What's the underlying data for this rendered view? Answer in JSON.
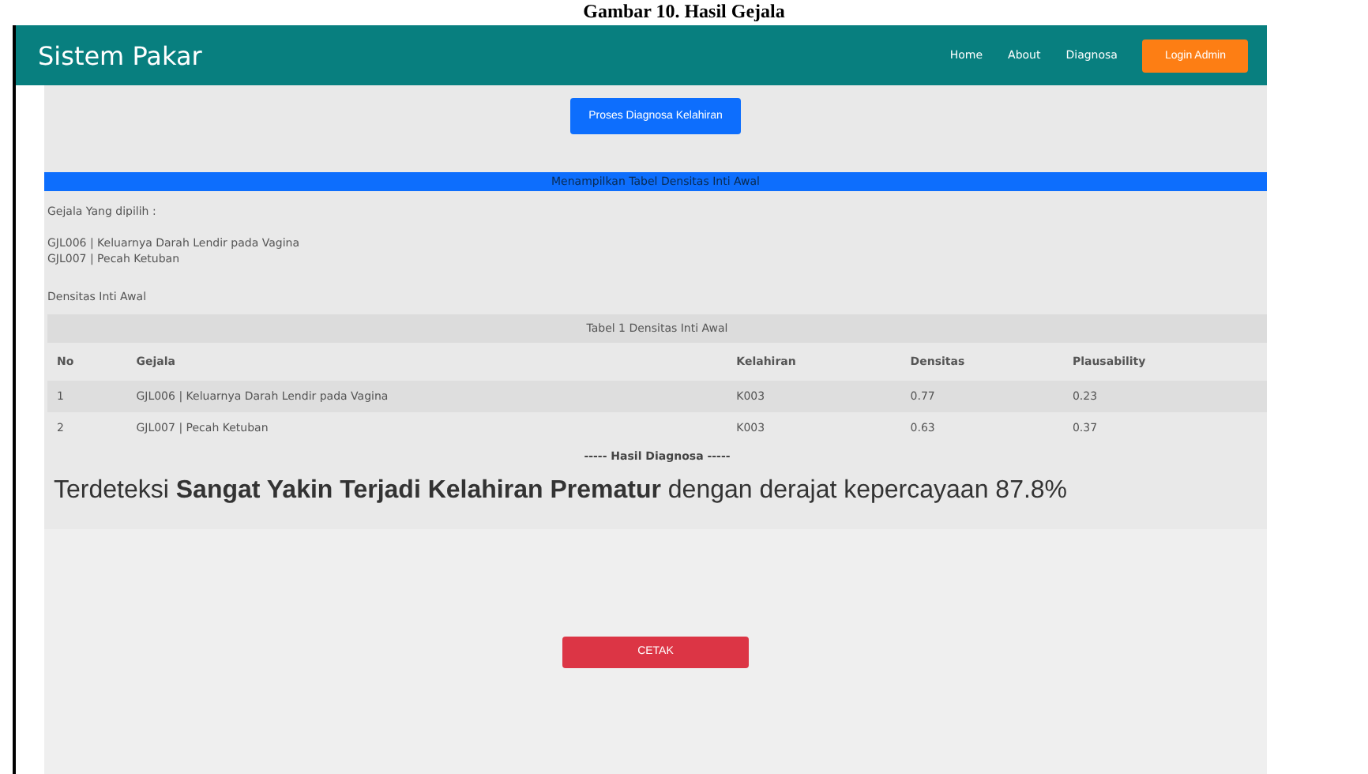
{
  "caption": "Gambar 10. Hasil Gejala",
  "navbar": {
    "brand": "Sistem Pakar",
    "links": [
      "Home",
      "About",
      "Diagnosa"
    ],
    "login_button": "Login Admin"
  },
  "process_button": "Proses Diagnosa Kelahiran",
  "section_bar": "Menampilkan Tabel Densitas Inti Awal",
  "selected_label": "Gejala Yang dipilih :",
  "selected_symptoms": [
    "GJL006 | Keluarnya Darah Lendir pada Vagina",
    "GJL007 | Pecah Ketuban"
  ],
  "density_label": "Densitas Inti Awal",
  "table": {
    "caption": "Tabel 1 Densitas Inti Awal",
    "columns": [
      "No",
      "Gejala",
      "Kelahiran",
      "Densitas",
      "Plausability"
    ],
    "rows": [
      [
        "1",
        "GJL006 | Keluarnya Darah Lendir pada Vagina",
        "K003",
        "0.77",
        "0.23"
      ],
      [
        "2",
        "GJL007 | Pecah Ketuban",
        "K003",
        "0.63",
        "0.37"
      ]
    ]
  },
  "result_heading": "----- Hasil Diagnosa -----",
  "result_text": "Terdeteksi **Sangat Yakin Terjadi Kelahiran Prematur** dengan derajat kepercayaan 87.8%",
  "print_button": "CETAK"
}
